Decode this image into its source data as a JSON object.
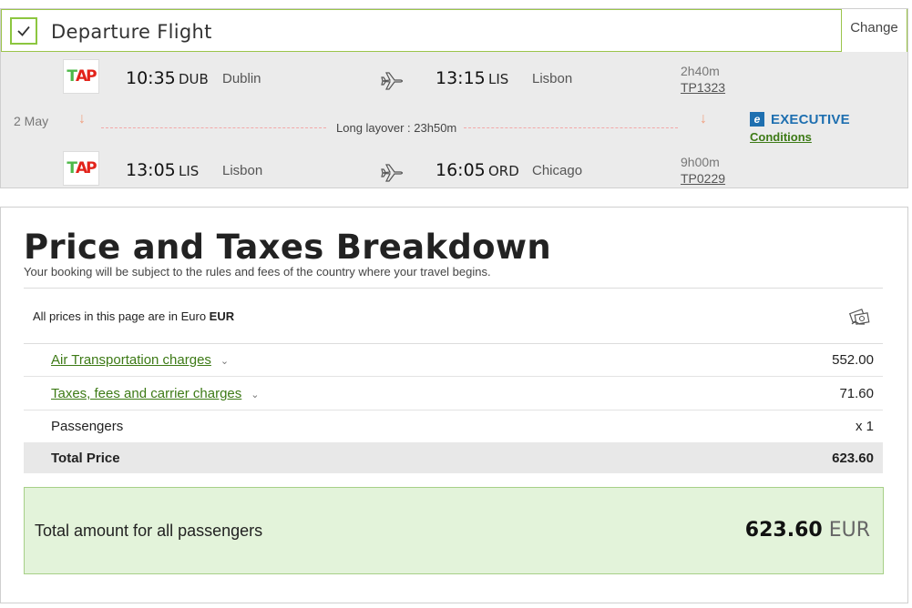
{
  "flight": {
    "title": "Departure Flight",
    "change_label": "Change",
    "segments": [
      {
        "airline_logo": "TAP",
        "dep_time": "10:35",
        "dep_code": "DUB",
        "dep_city": "Dublin",
        "arr_time": "13:15",
        "arr_code": "LIS",
        "arr_city": "Lisbon",
        "duration": "2h40m",
        "flight_number": "TP1323"
      },
      {
        "airline_logo": "TAP",
        "dep_time": "13:05",
        "dep_code": "LIS",
        "dep_city": "Lisbon",
        "arr_time": "16:05",
        "arr_code": "ORD",
        "arr_city": "Chicago",
        "duration": "9h00m",
        "flight_number": "TP0229"
      }
    ],
    "date": "2 May",
    "layover": "Long layover : 23h50m",
    "cabin_class": "EXECUTIVE",
    "conditions_label": "Conditions",
    "icons": {
      "check": "check-icon",
      "plane": "plane-icon",
      "arrow": "arrow-down-icon",
      "cabin": "executive-icon"
    }
  },
  "price": {
    "title": "Price and Taxes Breakdown",
    "subtitle": "Your booking will be subject to the rules and fees of the country where your travel begins.",
    "currency_note_prefix": "All prices in this page are in Euro",
    "currency_code": "EUR",
    "rows": [
      {
        "label": "Air Transportation charges",
        "value": "552.00"
      },
      {
        "label": "Taxes, fees and carrier charges",
        "value": "71.60"
      },
      {
        "label": "Passengers",
        "value": "x 1"
      }
    ],
    "total_label": "Total Price",
    "total_value": "623.60",
    "grand_label": "Total amount for all passengers",
    "grand_amount": "623.60",
    "grand_currency": "EUR"
  },
  "colors": {
    "accent_green": "#8cc63f",
    "link_green": "#3d7a16",
    "executive_blue": "#1e6fb0",
    "total_box_bg": "#e3f3da"
  }
}
